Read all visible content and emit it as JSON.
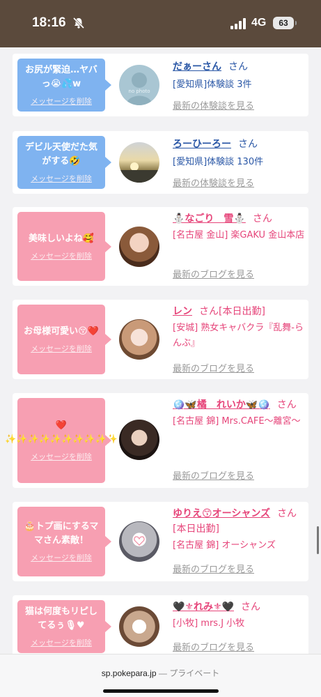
{
  "status_bar": {
    "time": "18:16",
    "network": "4G",
    "battery": "63"
  },
  "delete_label": "メッセージを削除",
  "cards": [
    {
      "theme": "blue",
      "message": "お尻が緊迫…ヤバっ😭💦w",
      "name": "だぁーさん",
      "suffix": "さん",
      "details": [
        "[愛知県]体験談 3件"
      ],
      "more": "最新の体験談を見る",
      "avatar_icon": "no-photo-avatar",
      "avatar_text": "no photo"
    },
    {
      "theme": "blue",
      "message": "デビル天使だた気がする🤣",
      "name": "ろーひーろー",
      "suffix": "さん",
      "details": [
        "[愛知県]体験談 130件"
      ],
      "more": "最新の体験談を見る",
      "avatar_icon": "sunset-avatar"
    },
    {
      "theme": "pink",
      "message": "美味しいよね🥰",
      "name": "⛄なごり　雪⛄",
      "suffix": "さん",
      "details": [
        "[名古屋 金山] 楽GAKU 金山本店"
      ],
      "more": "最新のブログを見る",
      "avatar_icon": "woman-photo-avatar"
    },
    {
      "theme": "pink",
      "message": "お母様可愛い😚❤️",
      "name": "レン",
      "suffix": "さん[本日出勤]",
      "details": [
        "[安城] 熟女キャバクラ『乱舞-らんぶ』"
      ],
      "more": "最新のブログを見る",
      "avatar_icon": "woman-photo-avatar"
    },
    {
      "theme": "pink",
      "message": "❤️ ✨✨✨✨✨✨✨✨✨✨",
      "name": "🪩🦋橘　れいか🦋🪩",
      "suffix": "さん",
      "details": [
        "[名古屋 錦] Mrs.CAFE〜離宮〜"
      ],
      "more": "最新のブログを見る",
      "avatar_icon": "woman-photo-avatar"
    },
    {
      "theme": "pink",
      "message": "🎂トプ画にするママさん素敵！",
      "name": "ゆりえ😙オーシャンズ",
      "suffix": "さん[本日出勤]",
      "details": [
        "[名古屋 錦] オーシャンズ"
      ],
      "more": "最新のブログを見る",
      "avatar_icon": "woman-photo-avatar"
    },
    {
      "theme": "pink",
      "message": "猫は何度もリピしてるぅ🎙♥",
      "name": "🖤⚜れみ⚜🖤",
      "suffix": "さん",
      "details": [
        "[小牧] mrs.J 小牧"
      ],
      "more": "最新のブログを見る",
      "avatar_icon": "woman-photo-avatar"
    }
  ],
  "url_bar": {
    "host": "sp.pokepara.jp",
    "mode": "— プライベート"
  }
}
